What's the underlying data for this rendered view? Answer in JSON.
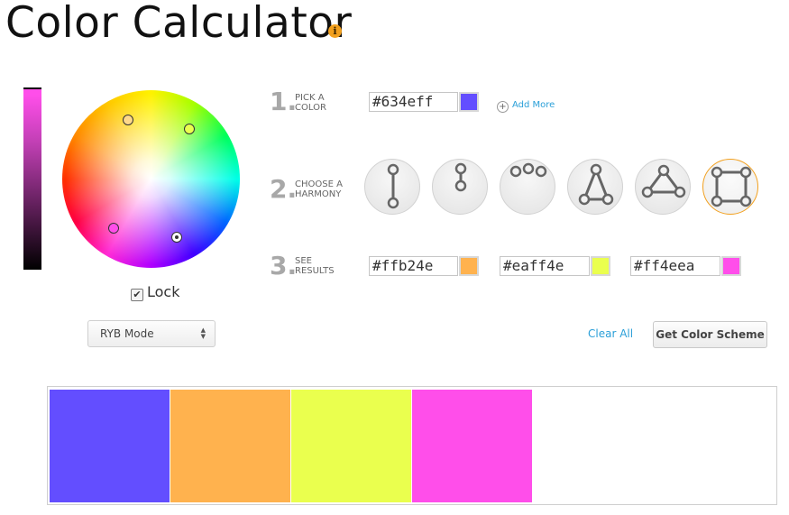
{
  "header": {
    "title": "Color Calculator",
    "info_icon": "info-icon"
  },
  "wheel": {
    "lock_label": "Lock",
    "lock_checked": true,
    "mode": "RYB Mode"
  },
  "step1": {
    "number": "1.",
    "label_line1": "PICK A",
    "label_line2": "COLOR",
    "hex": "#634eff",
    "color": "#634eff",
    "add_more": "Add More"
  },
  "step2": {
    "number": "2.",
    "label_line1": "CHOOSE A",
    "label_line2": "HARMONY",
    "options": [
      "complementary",
      "split-short",
      "analogous",
      "triad",
      "triangle",
      "square"
    ],
    "selected": "square"
  },
  "step3": {
    "number": "3.",
    "label_line1": "SEE",
    "label_line2": "RESULTS",
    "results": [
      {
        "hex": "#ffb24e",
        "color": "#ffb24e"
      },
      {
        "hex": "#eaff4e",
        "color": "#eaff4e"
      },
      {
        "hex": "#ff4eea",
        "color": "#ff4eea"
      }
    ]
  },
  "actions": {
    "clear_all": "Clear All",
    "get_scheme": "Get Color Scheme"
  },
  "scheme_swatches": [
    "#634eff",
    "#ffb24e",
    "#eaff4e",
    "#ff4eea"
  ]
}
